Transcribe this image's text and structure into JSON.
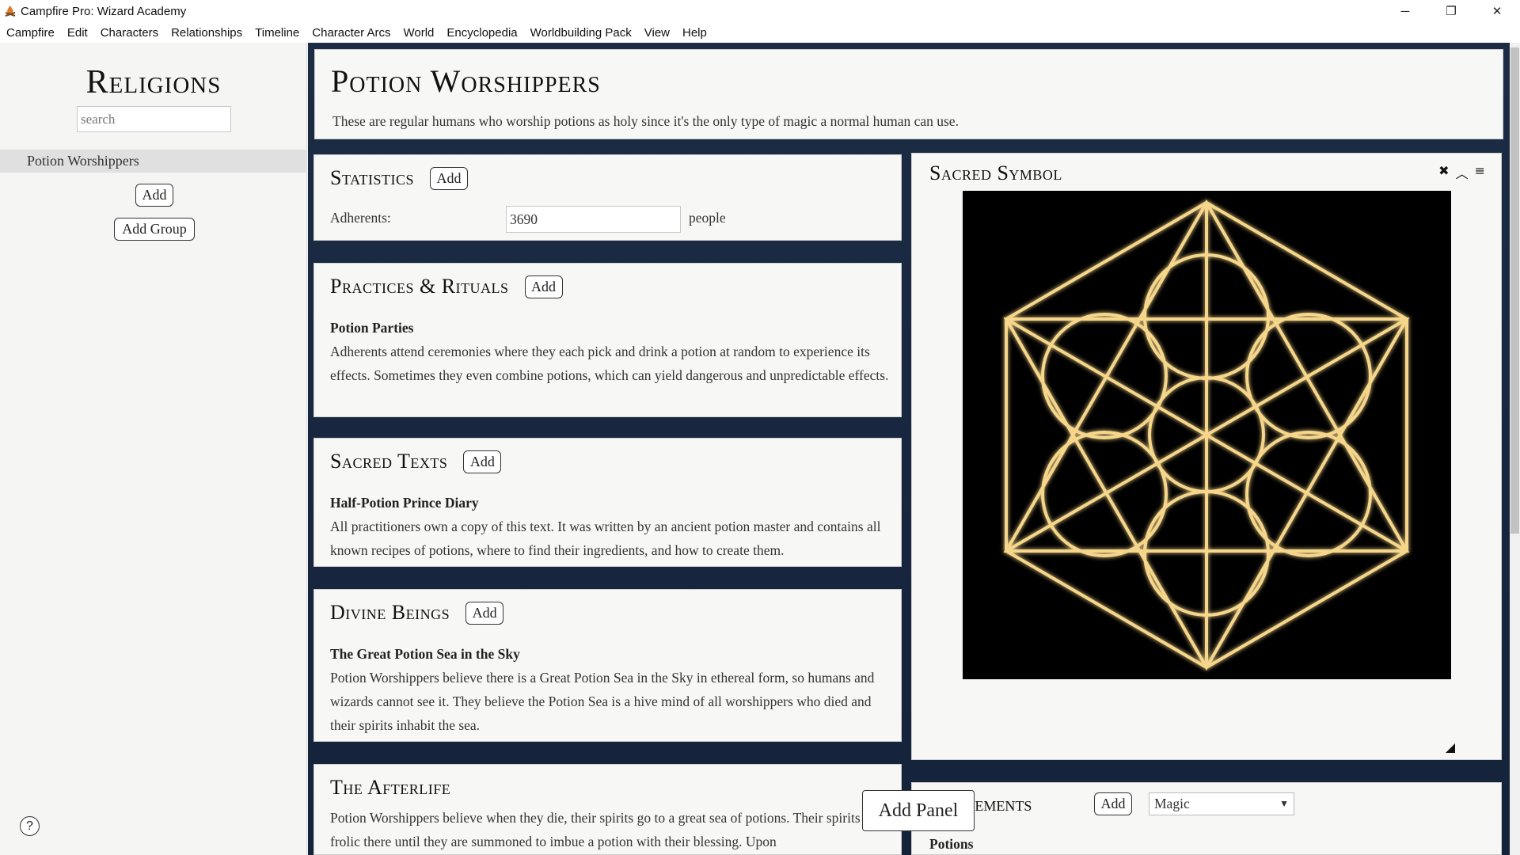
{
  "window": {
    "title": "Campfire Pro: Wizard Academy",
    "minimize": "─",
    "restore": "❐",
    "close": "✕"
  },
  "menu": [
    "Campfire",
    "Edit",
    "Characters",
    "Relationships",
    "Timeline",
    "Character Arcs",
    "World",
    "Encyclopedia",
    "Worldbuilding Pack",
    "View",
    "Help"
  ],
  "sidebar": {
    "title": "Religions",
    "search_placeholder": "search",
    "items": [
      {
        "label": "Potion Worshippers",
        "selected": true
      }
    ],
    "add_label": "Add",
    "add_group_label": "Add Group",
    "help_label": "?"
  },
  "header": {
    "title": "Potion Worshippers",
    "description": "These are regular humans who worship potions as holy since it's the only type of magic a normal human can use."
  },
  "statistics": {
    "heading": "Statistics",
    "add_label": "Add",
    "label": "Adherents:",
    "value": "3690",
    "unit": "people"
  },
  "practices": {
    "heading": "Practices & Rituals",
    "add_label": "Add",
    "entry_title": "Potion Parties",
    "entry_text": "Adherents attend ceremonies where they each pick and drink a potion at random to experience its effects. Sometimes they even combine potions, which can yield dangerous and unpredictable effects."
  },
  "sacred_texts": {
    "heading": "Sacred Texts",
    "add_label": "Add",
    "entry_title": "Half-Potion Prince Diary",
    "entry_text": "All practitioners own a copy of this text. It was written by an ancient potion master and contains all known recipes of potions, where to find their ingredients, and how to create them."
  },
  "divine_beings": {
    "heading": "Divine Beings",
    "add_label": "Add",
    "entry_title": "The Great Potion Sea in the Sky",
    "entry_text": "Potion Worshippers believe there is a Great Potion Sea in the Sky in ethereal form, so humans and wizards cannot see it. They believe the Potion Sea is a hive mind of all worshippers who died and their spirits inhabit the sea."
  },
  "afterlife": {
    "heading": "The Afterlife",
    "entry_text": "Potion Worshippers believe when they die, their spirits go to a great sea of potions. Their spirits frolic there until they are summoned to imbue a potion with their blessing. Upon"
  },
  "sacred_symbol": {
    "heading": "Sacred Symbol",
    "ctrl_close": "✖",
    "ctrl_collapse": "︿",
    "ctrl_menu": "≡"
  },
  "related_elements": {
    "heading": "ed Elements",
    "add_label": "Add",
    "select_value": "Magic",
    "item": "Potions"
  },
  "add_panel_label": "Add Panel",
  "colors": {
    "gold": "#f5d68a",
    "navy": "#1c2c44"
  }
}
